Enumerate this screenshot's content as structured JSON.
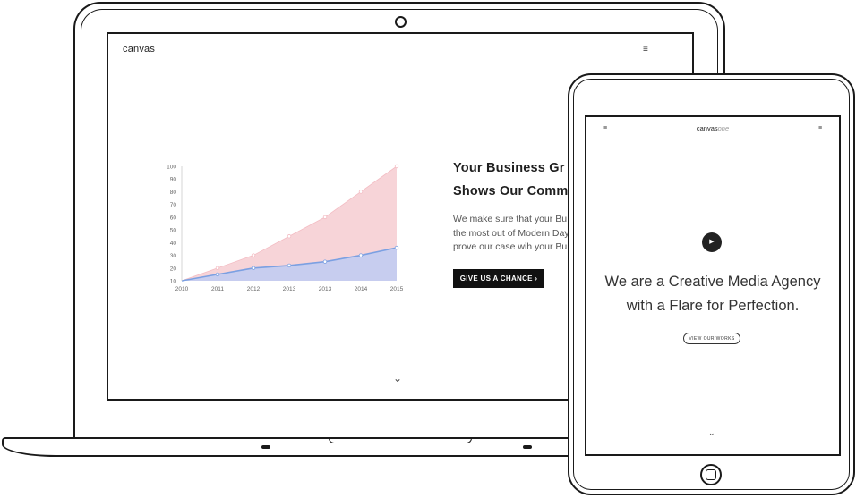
{
  "laptop": {
    "logo": "canvas",
    "menu_icon": "≡",
    "hero": {
      "title_line1": "Your Business Gr",
      "title_line2": "Shows Our Comm",
      "text_line1": "We make sure that your Bu",
      "text_line2": "the most out of Modern Day",
      "text_line3": "prove our case wih your Bu",
      "cta_label": "GIVE US A CHANCE  ›"
    },
    "scroll_icon": "⌄"
  },
  "chart_data": {
    "type": "area",
    "x": [
      "2010",
      "2011",
      "2012",
      "2013",
      "2013",
      "2014",
      "2015"
    ],
    "y_ticks": [
      10,
      20,
      30,
      40,
      50,
      60,
      70,
      80,
      90,
      100
    ],
    "ylim": [
      10,
      100
    ],
    "series": [
      {
        "values": [
          10,
          20,
          30,
          45,
          60,
          80,
          100
        ],
        "color": "#f7d4d8"
      },
      {
        "values": [
          10,
          15,
          20,
          22,
          25,
          30,
          36
        ],
        "color": "#c7cdef"
      }
    ],
    "line_color": "#7ba0e2",
    "grid": false
  },
  "tablet": {
    "logo_main": "canvas",
    "logo_accent": "one",
    "menu_icon_left": "≡",
    "menu_icon_right": "≡",
    "play_icon": "▶",
    "hero_line1": "We are a Creative Media Agency",
    "hero_line2": "with a Flare for Perfection.",
    "button_label": "VIEW OUR WORKS",
    "scroll_icon": "⌄"
  }
}
